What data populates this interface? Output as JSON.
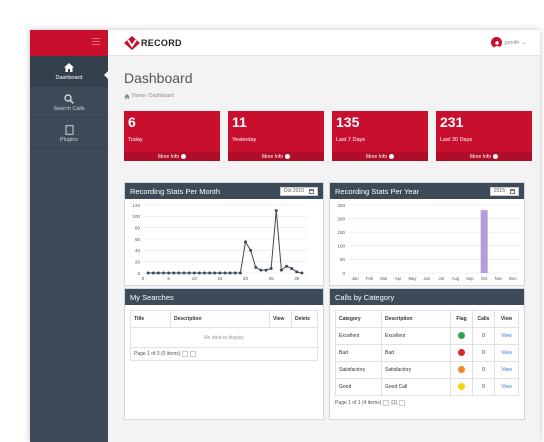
{
  "app": {
    "logo_text": "RECORD",
    "username": "jsmith"
  },
  "sidebar": {
    "items": [
      {
        "label": "Dashboard",
        "icon": "home-icon",
        "active": true
      },
      {
        "label": "Search Calls",
        "icon": "search-icon"
      },
      {
        "label": "Plugins",
        "icon": "plugin-icon"
      }
    ]
  },
  "page": {
    "title": "Dashboard",
    "breadcrumb": {
      "home": "Home",
      "current": "Dashboard"
    }
  },
  "tiles": [
    {
      "value": "6",
      "label": "Today",
      "more": "More Info"
    },
    {
      "value": "11",
      "label": "Yesterday",
      "more": "More Info"
    },
    {
      "value": "135",
      "label": "Last 7 Days",
      "more": "More Info"
    },
    {
      "value": "231",
      "label": "Last 30 Days",
      "more": "More Info"
    }
  ],
  "colors": {
    "brand": "#c8102e",
    "panel_header": "#3d4a57",
    "line": "#3d4a57",
    "bar": "#b39ddb"
  },
  "month_chart": {
    "title": "Recording Stats Per Month",
    "selector": "Oct 2015"
  },
  "year_chart": {
    "title": "Recording Stats Per Year",
    "selector": "2015"
  },
  "chart_data": [
    {
      "type": "line",
      "title": "Recording Stats Per Month",
      "x": [
        1,
        2,
        3,
        4,
        5,
        6,
        7,
        8,
        9,
        10,
        11,
        12,
        13,
        14,
        15,
        16,
        17,
        18,
        19,
        20,
        21,
        22,
        23,
        24,
        25,
        26,
        27,
        28,
        29,
        30,
        31
      ],
      "values": [
        0,
        0,
        0,
        0,
        0,
        0,
        0,
        0,
        0,
        0,
        0,
        0,
        0,
        0,
        0,
        0,
        0,
        0,
        0,
        55,
        40,
        10,
        5,
        5,
        8,
        110,
        5,
        12,
        8,
        2,
        0
      ],
      "xticks": [
        "0",
        "5",
        "10",
        "15",
        "20",
        "25",
        "30"
      ],
      "yticks": [
        "0",
        "20",
        "40",
        "60",
        "80",
        "100",
        "120"
      ],
      "xlim": [
        0,
        32
      ],
      "ylim": [
        0,
        120
      ],
      "grid": true
    },
    {
      "type": "bar",
      "title": "Recording Stats Per Year",
      "categories": [
        "Jan",
        "Feb",
        "Mar",
        "Apr",
        "May",
        "Jun",
        "Jul",
        "Aug",
        "Sep",
        "Oct",
        "Nov",
        "Dec"
      ],
      "values": [
        0,
        0,
        0,
        0,
        0,
        0,
        0,
        0,
        0,
        231,
        0,
        0
      ],
      "yticks": [
        "0",
        "50",
        "100",
        "150",
        "200",
        "250"
      ],
      "ylim": [
        0,
        250
      ],
      "grid": true
    }
  ],
  "searches": {
    "title": "My Searches",
    "columns": [
      "Title",
      "Description",
      "View",
      "Delete"
    ],
    "empty": "No data to display",
    "pager": "Page 1 of 0 (0 items)"
  },
  "calls": {
    "title": "Calls by Category",
    "columns": [
      "Category",
      "Description",
      "Flag",
      "Calls",
      "View"
    ],
    "rows": [
      {
        "category": "Excellent",
        "description": "Excellent",
        "flag": "#2ea44f",
        "calls": "0",
        "view": "View"
      },
      {
        "category": "Bad",
        "description": "Bad",
        "flag": "#d9232d",
        "calls": "0",
        "view": "View"
      },
      {
        "category": "Satisfactory",
        "description": "Satisfactory",
        "flag": "#f08a24",
        "calls": "0",
        "view": "View"
      },
      {
        "category": "Good",
        "description": "Good Call",
        "flag": "#f5d40f",
        "calls": "0",
        "view": "View"
      }
    ],
    "pager": "Page 1 of 1 (4 items)",
    "page_num": "[1]"
  }
}
